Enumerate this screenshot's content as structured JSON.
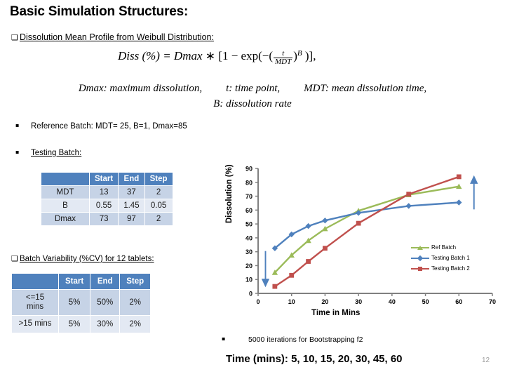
{
  "slide": {
    "title": "Basic Simulation Structures:",
    "page_number": "12"
  },
  "section_dissolution": {
    "bullet_mark": "❑",
    "heading": "Dissolution Mean Profile from Weibull Distribution:",
    "formula": {
      "lhs": "Diss (%) = Dmax",
      "op": "∗ [1 − exp(−(",
      "frac_num": "t",
      "frac_den": "MDT",
      "close": ")",
      "exponent": "B",
      "tail": " )],"
    },
    "definitions": {
      "dmax": "Dmax: maximum dissolution,",
      "t": "t: time point,",
      "mdt": "MDT: mean dissolution time,",
      "b": "B: dissolution rate"
    }
  },
  "batches": {
    "sub_mark": "▪",
    "reference": "Reference Batch: MDT= 25, B=1, Dmax=85",
    "testing": "Testing Batch:"
  },
  "table_sim": {
    "columns": [
      "",
      "Start",
      "End",
      "Step"
    ],
    "rows": [
      {
        "label": "MDT",
        "start": "13",
        "end": "37",
        "step": "2"
      },
      {
        "label": "B",
        "start": "0.55",
        "end": "1.45",
        "step": "0.05"
      },
      {
        "label": "Dmax",
        "start": "73",
        "end": "97",
        "step": "2"
      }
    ]
  },
  "section_variability": {
    "bullet_mark": "❑",
    "heading": "Batch Variability (%CV) for 12 tablets:"
  },
  "table_cv": {
    "columns": [
      "",
      "Start",
      "End",
      "Step"
    ],
    "rows": [
      {
        "label": "<=15 mins",
        "start": "5%",
        "end": "50%",
        "step": "2%"
      },
      {
        "label": ">15 mins",
        "start": "5%",
        "end": "30%",
        "step": "2%"
      }
    ]
  },
  "footer": {
    "bootstrap_mark": "▪",
    "bootstrap": "5000 iterations for Bootstrapping f2",
    "timepoints": "Time (mins): 5, 10, 15, 20, 30, 45, 60"
  },
  "colors": {
    "table_header": "#4F81BD",
    "table_row_odd": "#C6D3E6",
    "table_row_even": "#E3E9F3",
    "ref_batch": "#9BBB59",
    "testing_batch_1": "#4F81BD",
    "testing_batch_2": "#C0504D",
    "axis": "#808080",
    "arrow": "#4F81BD"
  },
  "chart_data": {
    "type": "line",
    "title": "",
    "xlabel": "Time in Mins",
    "ylabel": "Dissolution (%)",
    "xlim": [
      0,
      70
    ],
    "ylim": [
      0,
      90
    ],
    "xticks": [
      "0",
      "10",
      "20",
      "30",
      "40",
      "50",
      "60",
      "70"
    ],
    "yticks": [
      "0",
      "10",
      "20",
      "30",
      "40",
      "50",
      "60",
      "70",
      "80",
      "90"
    ],
    "grid": false,
    "legend_position": "right-middle",
    "x": [
      5,
      10,
      15,
      20,
      30,
      45,
      60
    ],
    "series": [
      {
        "name": "Ref Batch",
        "color": "#9BBB59",
        "marker": "triangle",
        "values": [
          15,
          27.5,
          38,
          46.5,
          59.5,
          71,
          77
        ]
      },
      {
        "name": "Testing Batch 1",
        "color": "#4F81BD",
        "marker": "diamond",
        "values": [
          32.5,
          42.5,
          48.5,
          52.5,
          58,
          63,
          65.5
        ]
      },
      {
        "name": "Testing Batch 2",
        "color": "#C0504D",
        "marker": "square",
        "values": [
          5,
          13,
          23,
          32.5,
          50.5,
          71.5,
          84
        ]
      }
    ],
    "annotations": [
      {
        "name": "down-arrow",
        "direction": "down",
        "x": 2.2,
        "y_from": 30.5,
        "y_to": 7.5
      },
      {
        "name": "up-arrow",
        "direction": "up",
        "x": 64.5,
        "y_from": 60.5,
        "y_to": 82
      }
    ]
  }
}
